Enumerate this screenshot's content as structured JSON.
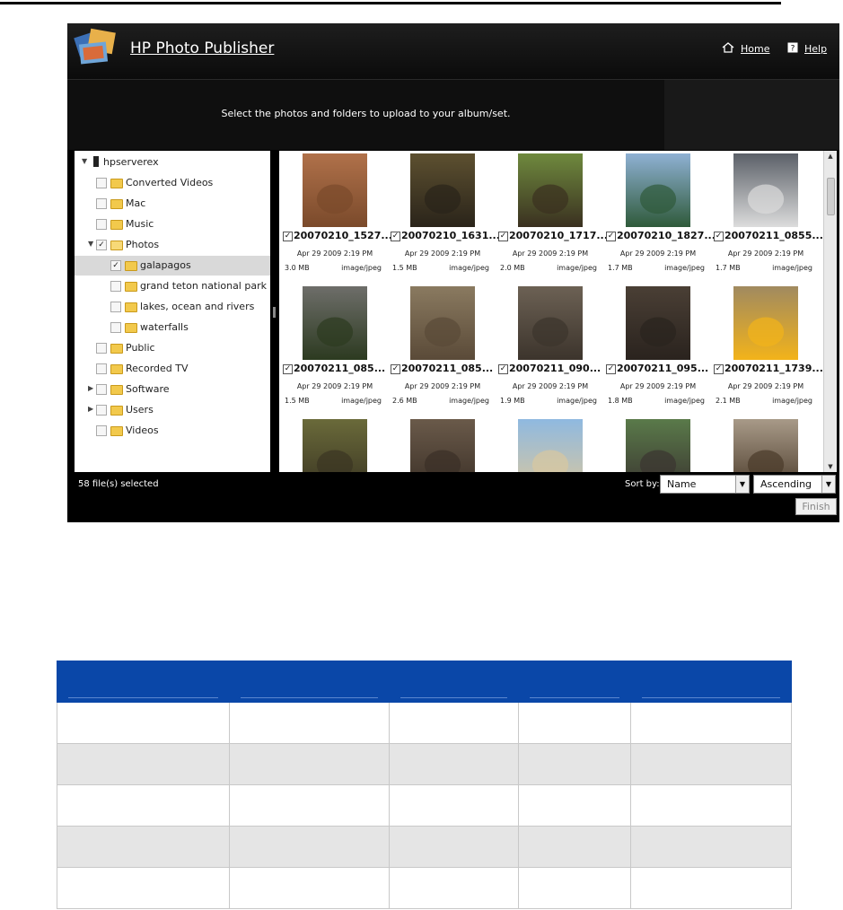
{
  "app": {
    "title": "HP Photo Publisher",
    "nav": {
      "home": "Home",
      "help": "Help"
    },
    "instruction": "Select the photos and folders to upload to your album/set."
  },
  "tree": {
    "root": "hpserverex",
    "items": [
      {
        "label": "Converted Videos",
        "checked": false
      },
      {
        "label": "Mac",
        "checked": false
      },
      {
        "label": "Music",
        "checked": false
      },
      {
        "label": "Photos",
        "checked": true,
        "expanded": true
      },
      {
        "label": "galapagos",
        "checked": true,
        "selected": true
      },
      {
        "label": "grand teton national park",
        "checked": false
      },
      {
        "label": "lakes, ocean and rivers",
        "checked": false
      },
      {
        "label": "waterfalls",
        "checked": false
      },
      {
        "label": "Public",
        "checked": false
      },
      {
        "label": "Recorded TV",
        "checked": false
      },
      {
        "label": "Software",
        "checked": false,
        "expandable": true
      },
      {
        "label": "Users",
        "checked": false,
        "expandable": true
      },
      {
        "label": "Videos",
        "checked": false
      }
    ]
  },
  "photos": [
    {
      "name": "20070210_1527...",
      "date": "Apr 29 2009 2:19 PM",
      "size": "3.0 MB",
      "type": "image/jpeg",
      "colors": [
        "#b0714a",
        "#7a4a2b"
      ]
    },
    {
      "name": "20070210_1631...",
      "date": "Apr 29 2009 2:19 PM",
      "size": "1.5 MB",
      "type": "image/jpeg",
      "colors": [
        "#5d5030",
        "#2a241a"
      ]
    },
    {
      "name": "20070210_1717...",
      "date": "Apr 29 2009 2:19 PM",
      "size": "2.0 MB",
      "type": "image/jpeg",
      "colors": [
        "#6f8a3e",
        "#3a3020"
      ]
    },
    {
      "name": "20070210_1827...",
      "date": "Apr 29 2009 2:19 PM",
      "size": "1.7 MB",
      "type": "image/jpeg",
      "colors": [
        "#8fb1d4",
        "#2f5a3a"
      ]
    },
    {
      "name": "20070211_0855...",
      "date": "Apr 29 2009 2:19 PM",
      "size": "1.7 MB",
      "type": "image/jpeg",
      "colors": [
        "#5b6068",
        "#dcdcdc"
      ]
    },
    {
      "name": "20070211_085...",
      "date": "Apr 29 2009 2:19 PM",
      "size": "1.5 MB",
      "type": "image/jpeg",
      "colors": [
        "#6e6e6a",
        "#2c3a20"
      ]
    },
    {
      "name": "20070211_085...",
      "date": "Apr 29 2009 2:19 PM",
      "size": "2.6 MB",
      "type": "image/jpeg",
      "colors": [
        "#8a7a60",
        "#5a4a38"
      ]
    },
    {
      "name": "20070211_090...",
      "date": "Apr 29 2009 2:19 PM",
      "size": "1.9 MB",
      "type": "image/jpeg",
      "colors": [
        "#6c6154",
        "#3c342c"
      ]
    },
    {
      "name": "20070211_095...",
      "date": "Apr 29 2009 2:19 PM",
      "size": "1.8 MB",
      "type": "image/jpeg",
      "colors": [
        "#4a3f35",
        "#2a231e"
      ]
    },
    {
      "name": "20070211_1739...",
      "date": "Apr 29 2009 2:19 PM",
      "size": "2.1 MB",
      "type": "image/jpeg",
      "colors": [
        "#a08a60",
        "#f2b31a"
      ]
    },
    {
      "name": "",
      "date": "",
      "size": "",
      "type": "",
      "colors": [
        "#6a6a3a",
        "#3a3522"
      ]
    },
    {
      "name": "",
      "date": "",
      "size": "",
      "type": "",
      "colors": [
        "#6a5a4a",
        "#3a2f26"
      ]
    },
    {
      "name": "",
      "date": "",
      "size": "",
      "type": "",
      "colors": [
        "#8fb9e0",
        "#d8c7a0"
      ]
    },
    {
      "name": "",
      "date": "",
      "size": "",
      "type": "",
      "colors": [
        "#5a7a4a",
        "#3a3430"
      ]
    },
    {
      "name": "",
      "date": "",
      "size": "",
      "type": "",
      "colors": [
        "#a89a88",
        "#4a3a2a"
      ]
    }
  ],
  "footer": {
    "status": "58 file(s) selected",
    "sort_label": "Sort by:",
    "sort_by": "Name",
    "sort_order": "Ascending",
    "finish": "Finish"
  },
  "table": {
    "columns": [
      "",
      "",
      "",
      "",
      ""
    ],
    "rows": [
      [
        "",
        "",
        "",
        "",
        ""
      ],
      [
        "",
        "",
        "",
        "",
        ""
      ],
      [
        "",
        "",
        "",
        "",
        ""
      ],
      [
        "",
        "",
        "",
        "",
        ""
      ],
      [
        "",
        "",
        "",
        "",
        ""
      ]
    ]
  }
}
